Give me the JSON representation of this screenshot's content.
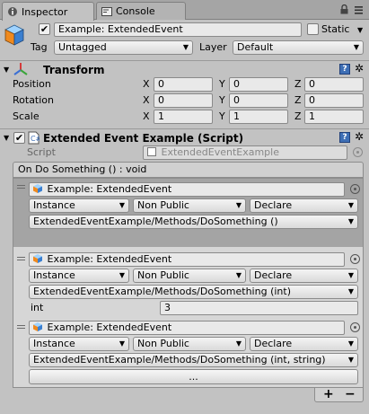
{
  "tabs": [
    {
      "label": "Inspector",
      "active": true
    },
    {
      "label": "Console",
      "active": false
    }
  ],
  "gameobject": {
    "name": "Example: ExtendedEvent",
    "active": true,
    "static_label": "Static",
    "static_checked": false,
    "tag_label": "Tag",
    "tag_value": "Untagged",
    "layer_label": "Layer",
    "layer_value": "Default"
  },
  "transform": {
    "title": "Transform",
    "rows": [
      {
        "label": "Position",
        "x": "0",
        "y": "0",
        "z": "0"
      },
      {
        "label": "Rotation",
        "x": "0",
        "y": "0",
        "z": "0"
      },
      {
        "label": "Scale",
        "x": "1",
        "y": "1",
        "z": "1"
      }
    ],
    "axis_x": "X",
    "axis_y": "Y",
    "axis_z": "Z"
  },
  "script_component": {
    "title": "Extended Event Example (Script)",
    "script_label": "Script",
    "script_value": "ExtendedEventExample",
    "event_header": "On Do Something () : void",
    "listeners": [
      {
        "target": "Example: ExtendedEvent",
        "binding": "Instance",
        "visibility": "Non Public",
        "mode": "Declare",
        "method": "ExtendedEventExample/Methods/DoSomething ()",
        "selected": true
      },
      {
        "target": "Example: ExtendedEvent",
        "binding": "Instance",
        "visibility": "Non Public",
        "mode": "Declare",
        "method": "ExtendedEventExample/Methods/DoSomething (int)",
        "param_label": "int",
        "param_value": "3",
        "selected": false
      },
      {
        "target": "Example: ExtendedEvent",
        "binding": "Instance",
        "visibility": "Non Public",
        "mode": "Declare",
        "method": "ExtendedEventExample/Methods/DoSomething (int, string)",
        "button_label": "...",
        "selected": false
      }
    ],
    "add_label": "+",
    "remove_label": "−"
  },
  "icons": {
    "inspector_tab": "info-icon",
    "console_tab": "console-icon",
    "lock": "lock-icon",
    "menu": "menu-icon",
    "gameobject": "cube-icon",
    "transform": "transform-axes-icon",
    "script": "script-icon",
    "help": "help-icon",
    "gear": "gear-icon"
  },
  "colors": {
    "background": "#c2c2c2",
    "selected_row": "#a4a4a4",
    "help_blue": "#3e6fb5"
  }
}
